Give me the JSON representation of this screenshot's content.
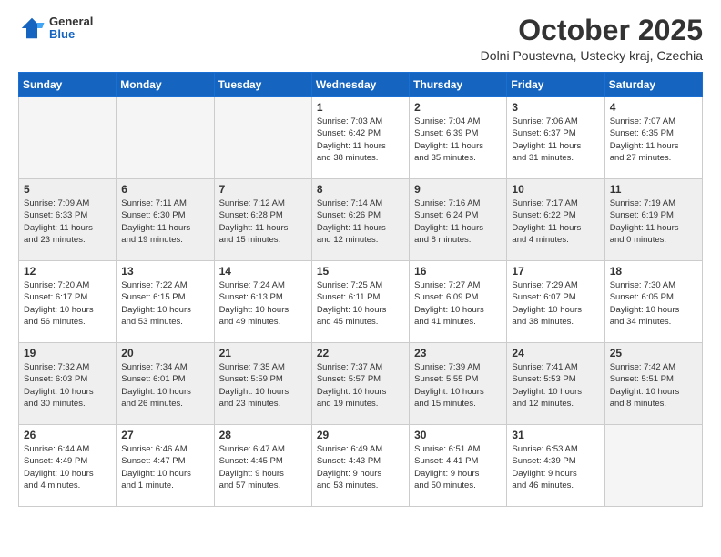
{
  "header": {
    "logo": {
      "general": "General",
      "blue": "Blue"
    },
    "title": "October 2025",
    "location": "Dolni Poustevna, Ustecky kraj, Czechia"
  },
  "weekdays": [
    "Sunday",
    "Monday",
    "Tuesday",
    "Wednesday",
    "Thursday",
    "Friday",
    "Saturday"
  ],
  "weeks": [
    [
      {
        "day": "",
        "info": ""
      },
      {
        "day": "",
        "info": ""
      },
      {
        "day": "",
        "info": ""
      },
      {
        "day": "1",
        "info": "Sunrise: 7:03 AM\nSunset: 6:42 PM\nDaylight: 11 hours\nand 38 minutes."
      },
      {
        "day": "2",
        "info": "Sunrise: 7:04 AM\nSunset: 6:39 PM\nDaylight: 11 hours\nand 35 minutes."
      },
      {
        "day": "3",
        "info": "Sunrise: 7:06 AM\nSunset: 6:37 PM\nDaylight: 11 hours\nand 31 minutes."
      },
      {
        "day": "4",
        "info": "Sunrise: 7:07 AM\nSunset: 6:35 PM\nDaylight: 11 hours\nand 27 minutes."
      }
    ],
    [
      {
        "day": "5",
        "info": "Sunrise: 7:09 AM\nSunset: 6:33 PM\nDaylight: 11 hours\nand 23 minutes."
      },
      {
        "day": "6",
        "info": "Sunrise: 7:11 AM\nSunset: 6:30 PM\nDaylight: 11 hours\nand 19 minutes."
      },
      {
        "day": "7",
        "info": "Sunrise: 7:12 AM\nSunset: 6:28 PM\nDaylight: 11 hours\nand 15 minutes."
      },
      {
        "day": "8",
        "info": "Sunrise: 7:14 AM\nSunset: 6:26 PM\nDaylight: 11 hours\nand 12 minutes."
      },
      {
        "day": "9",
        "info": "Sunrise: 7:16 AM\nSunset: 6:24 PM\nDaylight: 11 hours\nand 8 minutes."
      },
      {
        "day": "10",
        "info": "Sunrise: 7:17 AM\nSunset: 6:22 PM\nDaylight: 11 hours\nand 4 minutes."
      },
      {
        "day": "11",
        "info": "Sunrise: 7:19 AM\nSunset: 6:19 PM\nDaylight: 11 hours\nand 0 minutes."
      }
    ],
    [
      {
        "day": "12",
        "info": "Sunrise: 7:20 AM\nSunset: 6:17 PM\nDaylight: 10 hours\nand 56 minutes."
      },
      {
        "day": "13",
        "info": "Sunrise: 7:22 AM\nSunset: 6:15 PM\nDaylight: 10 hours\nand 53 minutes."
      },
      {
        "day": "14",
        "info": "Sunrise: 7:24 AM\nSunset: 6:13 PM\nDaylight: 10 hours\nand 49 minutes."
      },
      {
        "day": "15",
        "info": "Sunrise: 7:25 AM\nSunset: 6:11 PM\nDaylight: 10 hours\nand 45 minutes."
      },
      {
        "day": "16",
        "info": "Sunrise: 7:27 AM\nSunset: 6:09 PM\nDaylight: 10 hours\nand 41 minutes."
      },
      {
        "day": "17",
        "info": "Sunrise: 7:29 AM\nSunset: 6:07 PM\nDaylight: 10 hours\nand 38 minutes."
      },
      {
        "day": "18",
        "info": "Sunrise: 7:30 AM\nSunset: 6:05 PM\nDaylight: 10 hours\nand 34 minutes."
      }
    ],
    [
      {
        "day": "19",
        "info": "Sunrise: 7:32 AM\nSunset: 6:03 PM\nDaylight: 10 hours\nand 30 minutes."
      },
      {
        "day": "20",
        "info": "Sunrise: 7:34 AM\nSunset: 6:01 PM\nDaylight: 10 hours\nand 26 minutes."
      },
      {
        "day": "21",
        "info": "Sunrise: 7:35 AM\nSunset: 5:59 PM\nDaylight: 10 hours\nand 23 minutes."
      },
      {
        "day": "22",
        "info": "Sunrise: 7:37 AM\nSunset: 5:57 PM\nDaylight: 10 hours\nand 19 minutes."
      },
      {
        "day": "23",
        "info": "Sunrise: 7:39 AM\nSunset: 5:55 PM\nDaylight: 10 hours\nand 15 minutes."
      },
      {
        "day": "24",
        "info": "Sunrise: 7:41 AM\nSunset: 5:53 PM\nDaylight: 10 hours\nand 12 minutes."
      },
      {
        "day": "25",
        "info": "Sunrise: 7:42 AM\nSunset: 5:51 PM\nDaylight: 10 hours\nand 8 minutes."
      }
    ],
    [
      {
        "day": "26",
        "info": "Sunrise: 6:44 AM\nSunset: 4:49 PM\nDaylight: 10 hours\nand 4 minutes."
      },
      {
        "day": "27",
        "info": "Sunrise: 6:46 AM\nSunset: 4:47 PM\nDaylight: 10 hours\nand 1 minute."
      },
      {
        "day": "28",
        "info": "Sunrise: 6:47 AM\nSunset: 4:45 PM\nDaylight: 9 hours\nand 57 minutes."
      },
      {
        "day": "29",
        "info": "Sunrise: 6:49 AM\nSunset: 4:43 PM\nDaylight: 9 hours\nand 53 minutes."
      },
      {
        "day": "30",
        "info": "Sunrise: 6:51 AM\nSunset: 4:41 PM\nDaylight: 9 hours\nand 50 minutes."
      },
      {
        "day": "31",
        "info": "Sunrise: 6:53 AM\nSunset: 4:39 PM\nDaylight: 9 hours\nand 46 minutes."
      },
      {
        "day": "",
        "info": ""
      }
    ]
  ]
}
